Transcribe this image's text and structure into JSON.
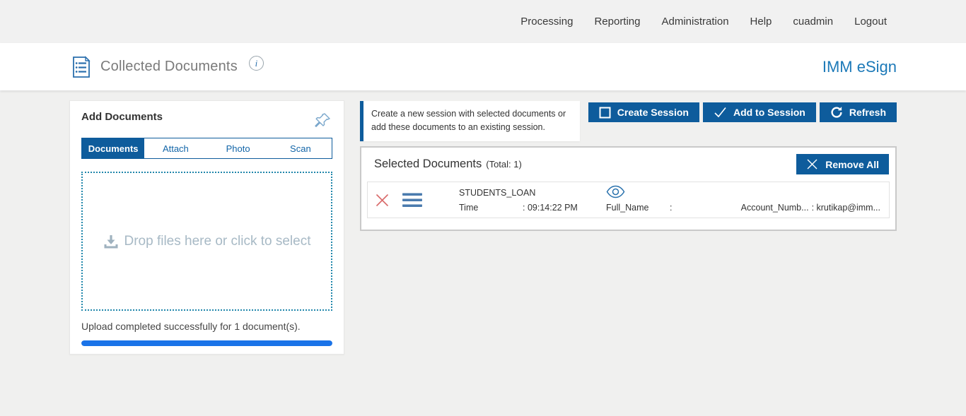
{
  "nav": {
    "items": [
      "Processing",
      "Reporting",
      "Administration",
      "Help",
      "cuadmin",
      "Logout"
    ]
  },
  "header": {
    "title": "Collected Documents",
    "info_icon": "i",
    "brand": "IMM eSign"
  },
  "add_documents": {
    "title": "Add Documents",
    "tabs": [
      {
        "label": "Documents",
        "active": true
      },
      {
        "label": "Attach",
        "active": false
      },
      {
        "label": "Photo",
        "active": false
      },
      {
        "label": "Scan",
        "active": false
      }
    ],
    "dropzone_text": "Drop files here or click to select",
    "upload_status": "Upload completed successfully for 1 document(s).",
    "progress_percent": 100
  },
  "session_actions": {
    "info_message": "Create a new session with selected documents or add these documents to an existing session.",
    "buttons": [
      {
        "label": "Create Session",
        "icon": "square-icon"
      },
      {
        "label": "Add to Session",
        "icon": "check-icon"
      },
      {
        "label": "Refresh",
        "icon": "refresh-icon"
      }
    ]
  },
  "selected_documents": {
    "title": "Selected Documents",
    "total_label": "(Total: 1)",
    "remove_all_label": "Remove All",
    "rows": [
      {
        "name": "STUDENTS_LOAN",
        "fields": [
          {
            "label": "Time",
            "value": ": 09:14:22 PM"
          },
          {
            "label": "Full_Name",
            "value": ":"
          },
          {
            "label": "Account_Numb...",
            "value": ": krutikap@imm..."
          }
        ]
      }
    ]
  },
  "colors": {
    "accent_blue": "#0e5c9c",
    "brand_blue": "#1c79b8",
    "progress_blue": "#1a73e8",
    "dropzone_border": "#2187ab",
    "remove_red": "#d96a6a"
  }
}
